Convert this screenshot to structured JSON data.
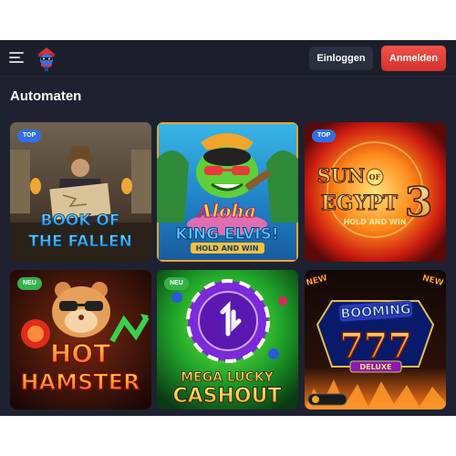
{
  "header": {
    "login_label": "Einloggen",
    "register_label": "Anmelden",
    "menu_icon": "hamburger-menu-icon",
    "logo_icon": "bandit-mascot-logo"
  },
  "section": {
    "title": "Automaten"
  },
  "games": [
    {
      "id": "book-of-the-fallen",
      "art_line1": "BOOK OF",
      "art_line2": "THE FALLEN",
      "badge": "TOP"
    },
    {
      "id": "aloha-king-elvis",
      "art_line1": "Aloha",
      "art_line2": "KING ELVIS!",
      "art_line3": "HOLD AND WIN",
      "badge": ""
    },
    {
      "id": "sun-of-egypt-3",
      "art_line1": "SUN",
      "art_line2": "OF",
      "art_line3": "EGYPT",
      "art_number": "3",
      "art_line4": "HOLD AND WIN",
      "badge": "TOP"
    },
    {
      "id": "hot-hamster",
      "art_line1": "HOT",
      "art_line2": "HAMSTER",
      "badge": "NEU"
    },
    {
      "id": "mega-lucky-cashout",
      "art_line1": "MEGA LUCKY",
      "art_line2": "CASHOUT",
      "badge": "NEU"
    },
    {
      "id": "booming-777-deluxe",
      "art_line1": "BOOMING",
      "art_number": "777",
      "art_line2": "DELUXE",
      "badge": "",
      "new_tag": "NEW"
    }
  ],
  "colors": {
    "app_bg": "#1e2230",
    "header_bg": "#1b1f2b",
    "register_button": "#e43f38",
    "login_button": "#2b3040",
    "badge_top": "#2f6ee8",
    "badge_neu": "#35b24a"
  }
}
